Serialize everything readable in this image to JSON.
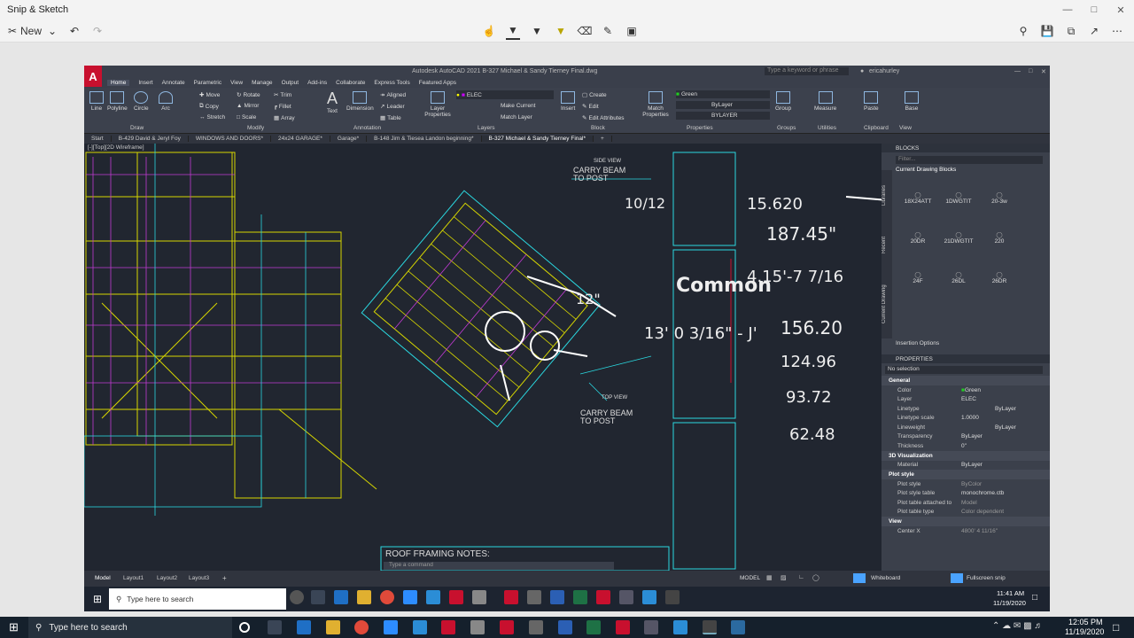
{
  "snip": {
    "title": "Snip & Sketch",
    "new_label": "New"
  },
  "acad": {
    "title": "Autodesk AutoCAD 2021   B-327 Michael & Sandy Tierney Final.dwg",
    "search_placeholder": "Type a keyword or phrase",
    "user": "ericahurley",
    "menu": [
      "Home",
      "Insert",
      "Annotate",
      "Parametric",
      "View",
      "Manage",
      "Output",
      "Add-ins",
      "Collaborate",
      "Express Tools",
      "Featured Apps"
    ],
    "ribbon": {
      "draw": [
        "Line",
        "Polyline",
        "Circle",
        "Arc"
      ],
      "draw_panel": "Draw",
      "modify_items": [
        "Move",
        "Rotate",
        "Trim",
        "Copy",
        "Mirror",
        "Fillet",
        "Stretch",
        "Scale",
        "Array"
      ],
      "modify_panel": "Modify",
      "text": "Text",
      "dimension": "Dimension",
      "annot_items": [
        "Aligned",
        "Leader",
        "Table"
      ],
      "annotation_panel": "Annotation",
      "layer_props": "Layer Properties",
      "layer_name": "ELEC",
      "layer_items": [
        "Make Current",
        "Match Layer"
      ],
      "layers_panel": "Layers",
      "insert": "Insert",
      "block_items": [
        "Create",
        "Edit",
        "Edit Attributes"
      ],
      "block_panel": "Block",
      "match_props": "Match Properties",
      "color": "Green",
      "bylayer": "ByLayer",
      "bylayer2": "BYLAYER",
      "properties_panel": "Properties",
      "group": "Group",
      "groups_panel": "Groups",
      "measure": "Measure",
      "utilities_panel": "Utilities",
      "paste": "Paste",
      "clipboard_panel": "Clipboard",
      "base": "Base",
      "view_panel": "View"
    },
    "tabs": [
      "Start",
      "B-429 David & Jeryl Foy",
      "WINDOWS AND DOORS*",
      "24x24 GARAGE*",
      "Garage*",
      "B-148 Jim & Tiesea Landon beginning*",
      "B-327 Michael & Sandy Tierney Final*"
    ],
    "viewport_label": "[-][Top][2D Wireframe]",
    "drawing_labels": {
      "side_view": "SIDE VIEW",
      "carry_beam_top": "CARRY BEAM TO POST",
      "top_view": "TOP VIEW",
      "carry_beam_bottom": "CARRY BEAM TO POST",
      "roof_notes": "ROOF FRAMING NOTES:",
      "command_placeholder": "Type a command"
    },
    "handwriting": [
      "10/12",
      "15.620",
      "187.45\"",
      "Common",
      "4.15'-7 7/16",
      "12\"",
      "13' 0 3/16\" - J'",
      "156.20",
      "124.96",
      "93.72",
      "62.48"
    ],
    "blocks": {
      "header": "BLOCKS",
      "filter": "Filter...",
      "current": "Current Drawing Blocks",
      "items": [
        "18X24ATT",
        "1DWGTIT",
        "20-3w",
        "20DR",
        "21DWGTIT",
        "220",
        "24F",
        "26DL",
        "26DR"
      ],
      "insertion": "Insertion Options",
      "side_tabs": [
        "Current Drawing",
        "Recent",
        "Libraries"
      ]
    },
    "properties": {
      "header": "PROPERTIES",
      "selection": "No selection",
      "general": "General",
      "rows": [
        {
          "k": "Color",
          "v": "Green"
        },
        {
          "k": "Layer",
          "v": "ELEC"
        },
        {
          "k": "Linetype",
          "v": "ByLayer"
        },
        {
          "k": "Linetype scale",
          "v": "1.0000"
        },
        {
          "k": "Lineweight",
          "v": "ByLayer"
        },
        {
          "k": "Transparency",
          "v": "ByLayer"
        },
        {
          "k": "Thickness",
          "v": "0\""
        }
      ],
      "viz": "3D Visualization",
      "material": {
        "k": "Material",
        "v": "ByLayer"
      },
      "plot": "Plot style",
      "plot_rows": [
        {
          "k": "Plot style",
          "v": "ByColor"
        },
        {
          "k": "Plot style table",
          "v": "monochrome.ctb"
        },
        {
          "k": "Plot table attached to",
          "v": "Model"
        },
        {
          "k": "Plot table type",
          "v": "Color dependent"
        }
      ],
      "view": "View",
      "center": {
        "k": "Center X",
        "v": "4800' 4 11/16\""
      }
    },
    "layouts": [
      "Model",
      "Layout1",
      "Layout2",
      "Layout3"
    ],
    "status_model": "MODEL",
    "whiteboard": "Whiteboard",
    "fullscreen": "Fullscreen snip"
  },
  "vm_taskbar": {
    "search": "Type here to search",
    "time": "11:41 AM",
    "date": "11/19/2020"
  },
  "taskbar": {
    "search": "Type here to search",
    "time": "12:05 PM",
    "date": "11/19/2020"
  }
}
